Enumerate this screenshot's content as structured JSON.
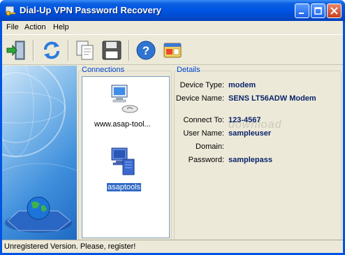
{
  "window": {
    "title": "Dial-Up VPN Password Recovery"
  },
  "menu": [
    {
      "label": "File"
    },
    {
      "label": "Action"
    },
    {
      "label": "Help"
    }
  ],
  "toolbar": {
    "buttons": [
      {
        "icon": "exit-door-icon"
      },
      {
        "icon": "refresh-icon"
      },
      {
        "icon": "copy-icon"
      },
      {
        "icon": "save-icon"
      },
      {
        "icon": "help-icon"
      },
      {
        "icon": "about-icon"
      }
    ]
  },
  "connections": {
    "label": "Connections",
    "items": [
      {
        "name": "www.asap-tool...",
        "selected": false
      },
      {
        "name": "asaptools",
        "selected": true
      }
    ]
  },
  "details": {
    "label": "Details",
    "fields": [
      {
        "label": "Device Type:",
        "value": "modem"
      },
      {
        "label": "Device Name:",
        "value": "SENS LT56ADW Modem"
      },
      {
        "label": "Connect To:",
        "value": "123-4567"
      },
      {
        "label": "User Name:",
        "value": "sampleuser"
      },
      {
        "label": "Domain:",
        "value": ""
      },
      {
        "label": "Password:",
        "value": "samplepass"
      }
    ]
  },
  "watermark": "download",
  "status": {
    "text": "Unregistered Version. Please, register!"
  },
  "colors": {
    "title_blue": "#0054e3",
    "group_label": "#0046d5",
    "value_text": "#0a246a",
    "selection": "#316ac5"
  }
}
